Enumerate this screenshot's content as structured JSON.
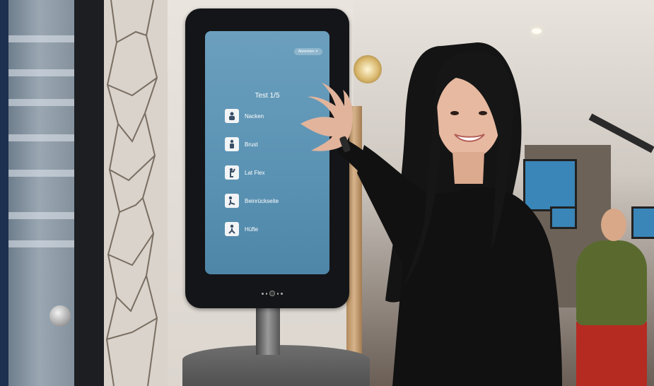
{
  "kiosk": {
    "language_button": "Abmelden ✕",
    "test_title": "Test 1/5",
    "items": [
      {
        "label": "Nacken",
        "icon": "neck-exercise-icon"
      },
      {
        "label": "Brust",
        "icon": "chest-exercise-icon"
      },
      {
        "label": "Lat Flex",
        "icon": "lat-flex-exercise-icon"
      },
      {
        "label": "Beinrückseite",
        "icon": "hamstring-exercise-icon"
      },
      {
        "label": "Hüfte",
        "icon": "hip-exercise-icon"
      }
    ]
  },
  "colors": {
    "screen": "#5a92b3",
    "bezel": "#141518",
    "frame_strip": "#1d3050"
  }
}
